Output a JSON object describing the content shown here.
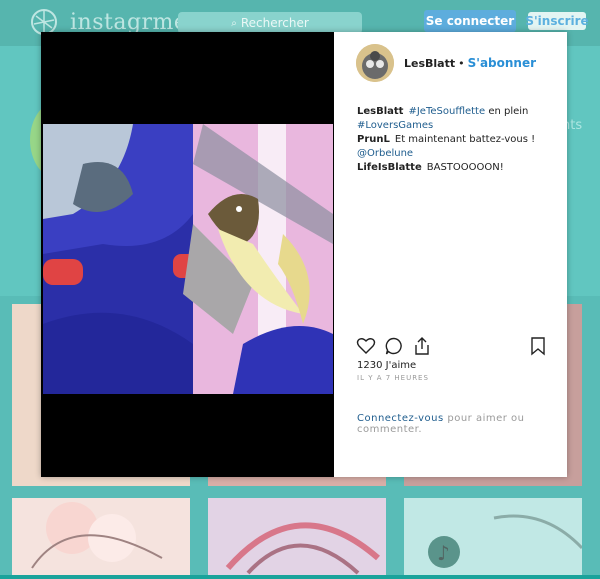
{
  "header": {
    "logo_text": "instagrme",
    "search_icon": "⌕",
    "search_placeholder": "Rechercher",
    "connect_label": "Se connecter",
    "signup_label": "S'inscrire"
  },
  "profile": {
    "stat_fragment": "nts"
  },
  "post": {
    "username": "LesBlatt",
    "separator": "•",
    "follow_label": "S'abonner",
    "comments": [
      {
        "user": "LesBlatt",
        "parts": [
          {
            "t": "#JeTeSoufflette",
            "tag": true
          },
          {
            "t": " en plein ",
            "tag": false
          },
          {
            "t": "#LoversGames",
            "tag": true
          }
        ]
      },
      {
        "user": "PrunL",
        "parts": [
          {
            "t": "Et maintenant battez-vous ! ",
            "tag": false
          },
          {
            "t": "@Orbelune",
            "tag": true
          }
        ]
      },
      {
        "user": "LifeIsBlatte",
        "parts": [
          {
            "t": "BASTOOOOON!",
            "tag": false
          }
        ]
      }
    ],
    "likes_text": "1230 J'aime",
    "time_text": "IL Y A 7 HEURES",
    "login_link": "Connectez-vous",
    "login_rest": " pour aimer ou commenter."
  },
  "icons": {
    "like": "heart-icon",
    "comment": "comment-bubble-icon",
    "share": "share-icon",
    "save": "bookmark-icon"
  },
  "colors": {
    "background": "#1aa39b",
    "accent_blue": "#2a8fd6",
    "tag_blue": "#1f5d8e"
  }
}
